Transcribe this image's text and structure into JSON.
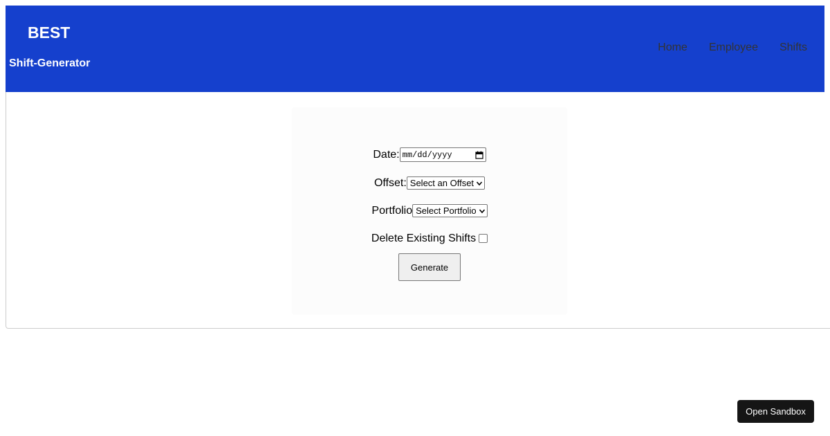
{
  "header": {
    "brand_title": "BEST",
    "brand_subtitle": "Shift-Generator",
    "nav": [
      {
        "label": "Home"
      },
      {
        "label": "Employee"
      },
      {
        "label": "Shifts"
      }
    ],
    "background": "#1540cd"
  },
  "form": {
    "date_label": "Date:",
    "date_placeholder": "mm/dd/yyyy",
    "offset_label": "Offset:",
    "offset_selected": "Select an Offset",
    "portfolio_label": "Portfolio",
    "portfolio_selected": "Select Portfolio",
    "delete_label": "Delete Existing Shifts",
    "delete_checked": false,
    "generate_label": "Generate"
  },
  "sandbox": {
    "label": "Open Sandbox"
  }
}
